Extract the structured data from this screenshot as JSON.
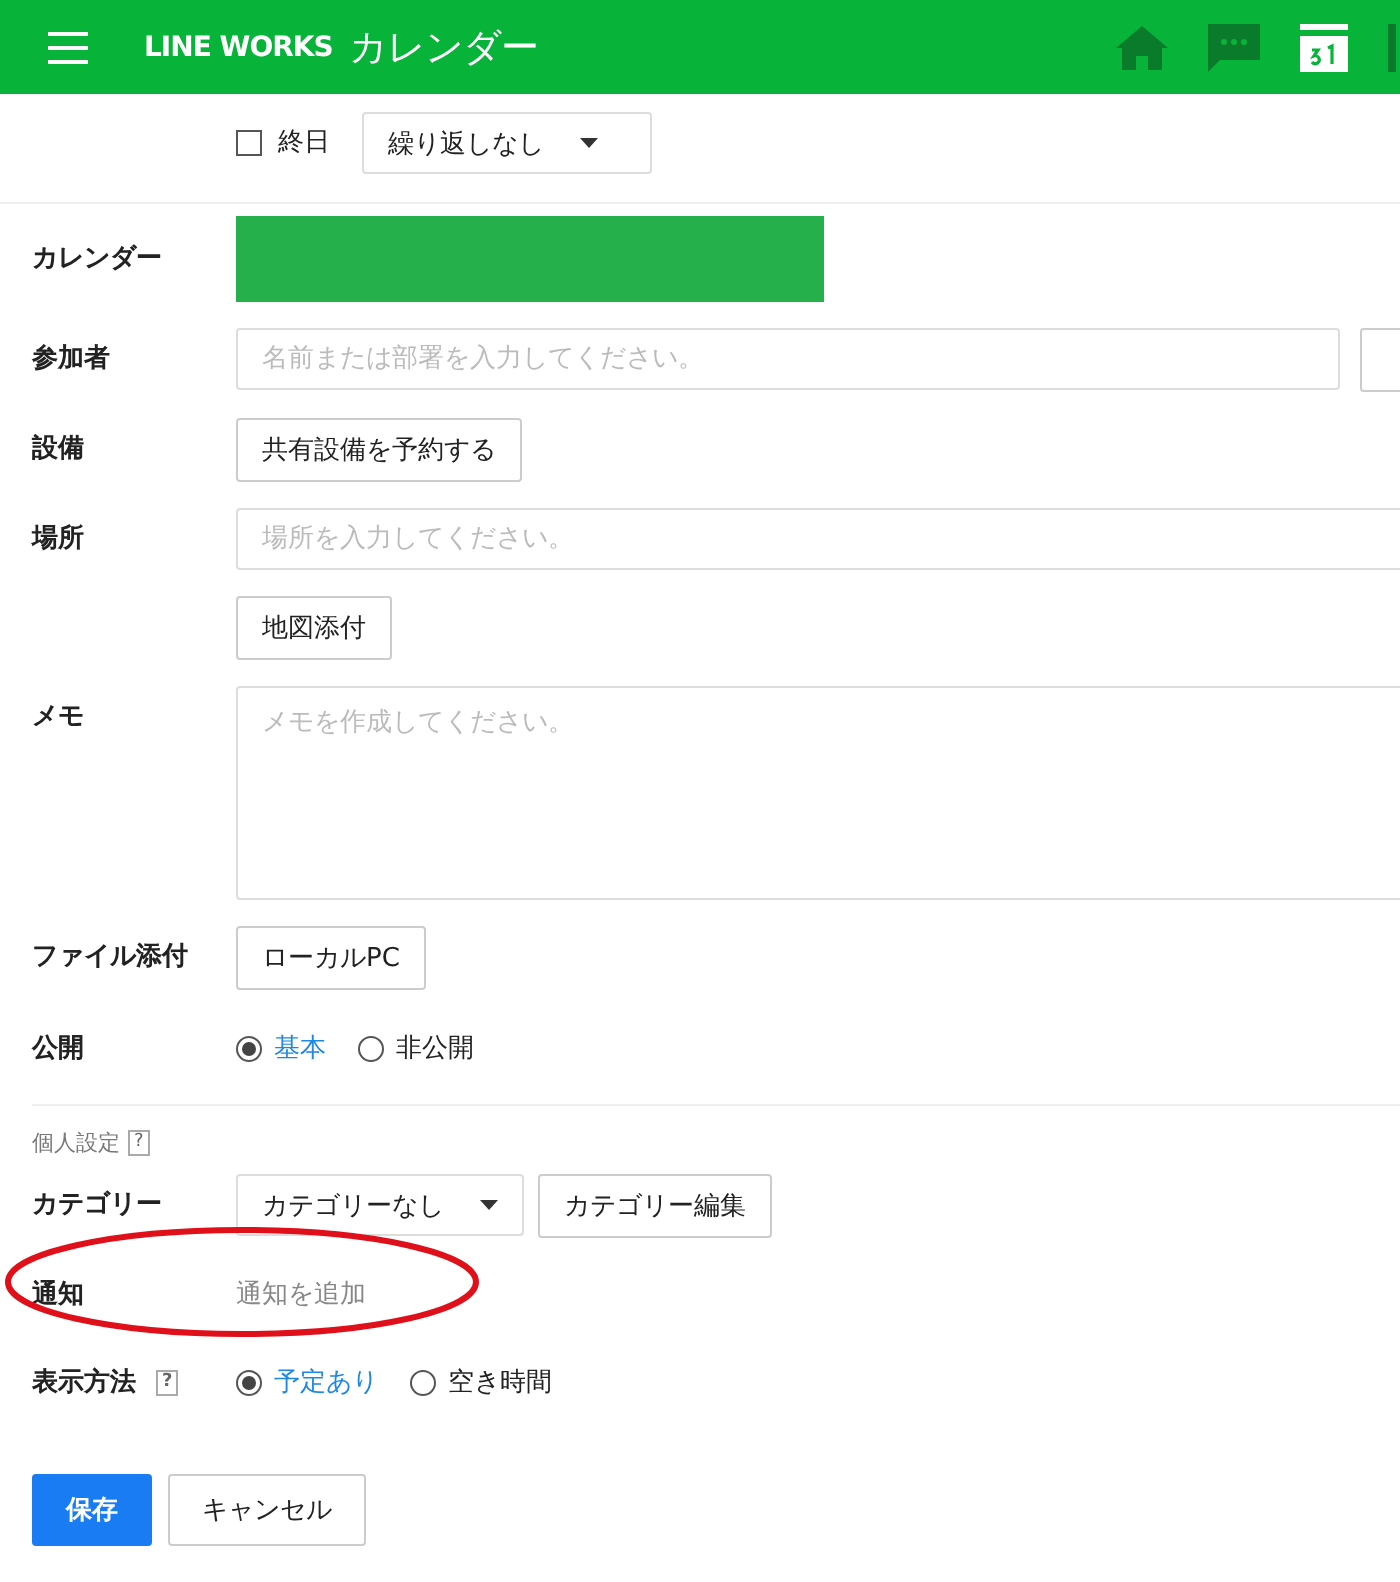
{
  "header": {
    "brand": "LINE WORKS",
    "title": "カレンダー"
  },
  "all_day": {
    "label": "終日",
    "checked": false
  },
  "repeat": {
    "value": "繰り返しなし"
  },
  "rows": [
    {
      "kind": "calendar",
      "label": "カレンダー"
    },
    {
      "kind": "input",
      "label": "参加者",
      "placeholder": "名前または部署を入力してください。"
    },
    {
      "kind": "button",
      "label": "設備",
      "button": "共有設備を予約する"
    },
    {
      "kind": "input_wide",
      "label": "場所",
      "placeholder": "場所を入力してください。"
    },
    {
      "kind": "button",
      "label": "",
      "button": "地図添付"
    },
    {
      "kind": "textarea",
      "label": "メモ",
      "placeholder": "メモを作成してください。"
    },
    {
      "kind": "button",
      "label": "ファイル添付",
      "button": "ローカルPC"
    }
  ],
  "visibility": {
    "label": "公開",
    "options": [
      {
        "label": "基本",
        "selected": true
      },
      {
        "label": "非公開",
        "selected": false
      }
    ]
  },
  "personal": {
    "title": "個人設定",
    "help": "?"
  },
  "category": {
    "label": "カテゴリー",
    "value": "カテゴリーなし",
    "edit": "カテゴリー編集"
  },
  "notification": {
    "label": "通知",
    "action": "通知を追加",
    "highlighted": true
  },
  "display": {
    "label": "表示方法",
    "help": "?",
    "options": [
      {
        "label": "予定あり",
        "selected": true
      },
      {
        "label": "空き時間",
        "selected": false
      }
    ]
  },
  "buttons": {
    "save": "保存",
    "cancel": "キャンセル"
  }
}
